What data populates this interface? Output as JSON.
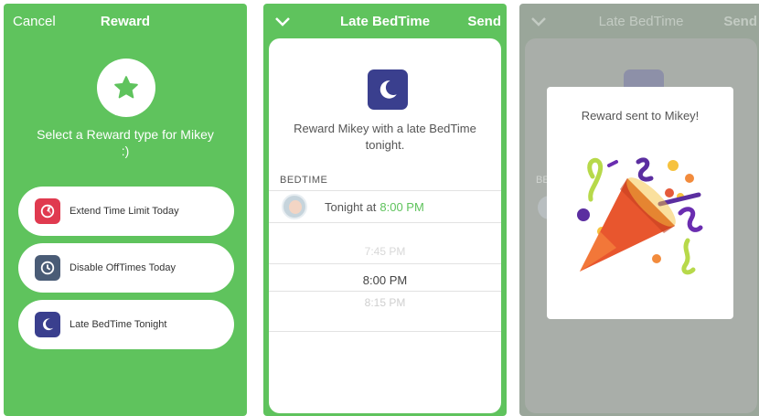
{
  "screen1": {
    "cancel_label": "Cancel",
    "title": "Reward",
    "prompt": "Select a Reward type for Mikey :)",
    "options": [
      {
        "label": "Extend Time Limit Today",
        "icon": "timer-icon",
        "color": "#e03a4f"
      },
      {
        "label": "Disable OffTimes Today",
        "icon": "clock-icon",
        "color": "#4a5c76"
      },
      {
        "label": "Late BedTime Tonight",
        "icon": "moon-icon",
        "color": "#3a3f8e"
      }
    ]
  },
  "screen2": {
    "title": "Late BedTime",
    "send_label": "Send",
    "message": "Reward Mikey with a late BedTime tonight.",
    "section_header": "BEDTIME",
    "row_prefix": "Tonight at",
    "row_time": "8:00 PM",
    "picker": [
      "7:45 PM",
      "8:00 PM",
      "8:15 PM"
    ]
  },
  "screen3": {
    "title": "Late BedTime",
    "send_label": "Send",
    "section_header": "BE",
    "modal_message": "Reward sent to Mikey!",
    "modal_icon": "party-popper-icon"
  },
  "colors": {
    "accent": "#5fc35d",
    "moon": "#3a3f8e"
  }
}
